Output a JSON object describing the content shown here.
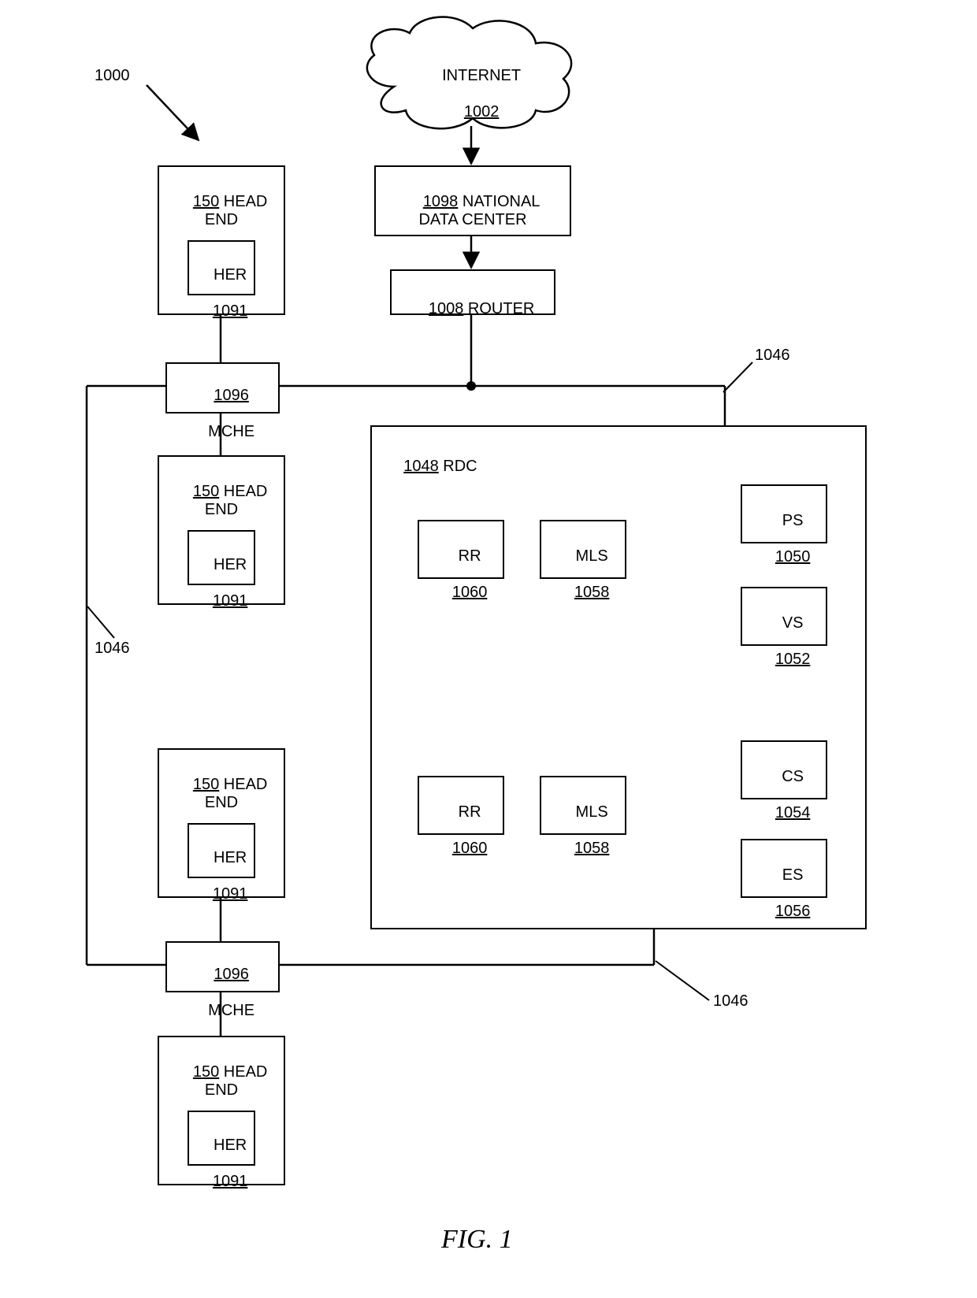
{
  "figure_label": "FIG. 1",
  "ref_1000": "1000",
  "ref_1046_left": "1046",
  "ref_1046_upper_right": "1046",
  "ref_1046_lower_right": "1046",
  "internet": {
    "name": "INTERNET",
    "id": "1002"
  },
  "ndc": {
    "id": "1098",
    "name": "NATIONAL\nDATA CENTER"
  },
  "router": {
    "id": "1008",
    "name": "ROUTER"
  },
  "headend": {
    "id": "150",
    "name": "HEAD\nEND"
  },
  "her": {
    "name": "HER",
    "id": "1091"
  },
  "mche": {
    "id": "1096",
    "name": "MCHE"
  },
  "rdc": {
    "id": "1048",
    "name": "RDC"
  },
  "rr": {
    "name": "RR",
    "id": "1060"
  },
  "mls": {
    "name": "MLS",
    "id": "1058"
  },
  "ps": {
    "name": "PS",
    "id": "1050"
  },
  "vs": {
    "name": "VS",
    "id": "1052"
  },
  "cs": {
    "name": "CS",
    "id": "1054"
  },
  "es": {
    "name": "ES",
    "id": "1056"
  }
}
